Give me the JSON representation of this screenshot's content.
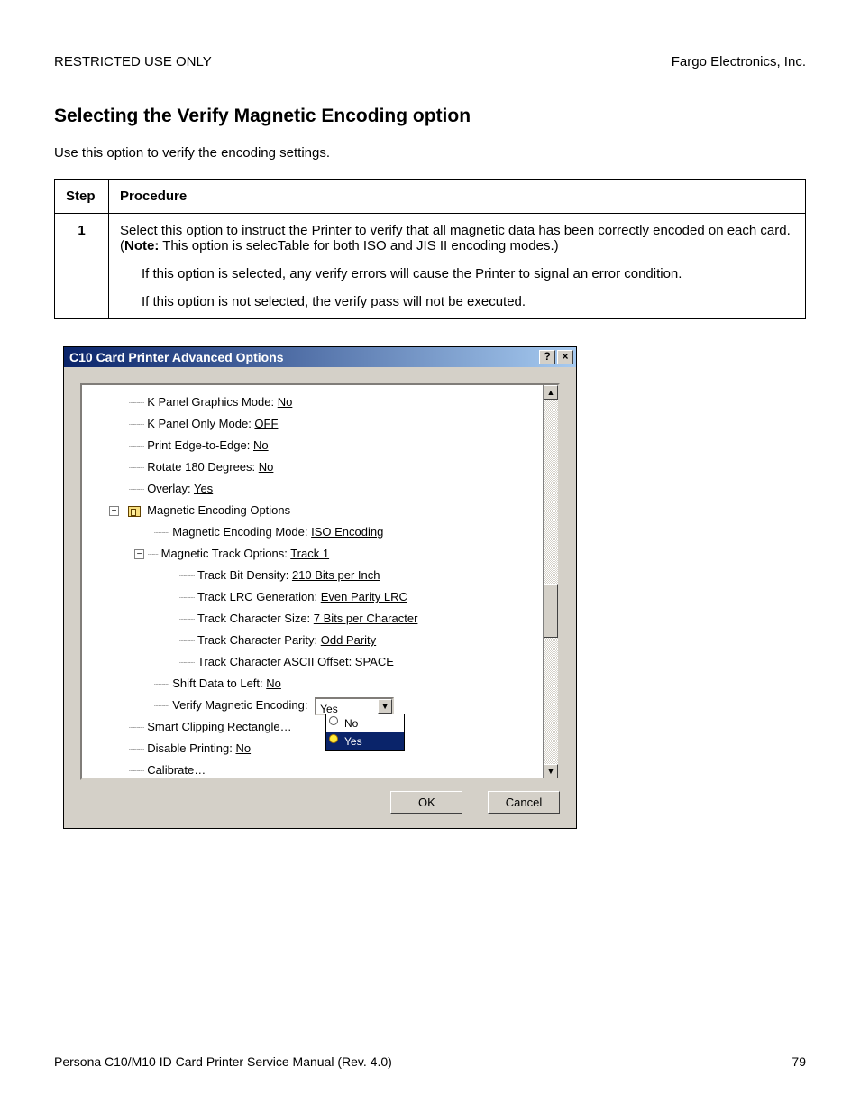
{
  "header": {
    "left": "RESTRICTED USE ONLY",
    "right": "Fargo Electronics, Inc."
  },
  "title": "Selecting the Verify Magnetic Encoding option",
  "intro": "Use this option to verify the encoding settings.",
  "table": {
    "col_step": "Step",
    "col_proc": "Procedure",
    "step_num": "1",
    "p1a": "Select this option to instruct the Printer to verify that all magnetic data has been correctly encoded on each card. (",
    "p1_note": "Note:",
    "p1b": "  This option is selecTable for both ISO and JIS II encoding modes.)",
    "p2": "If this option is selected, any verify errors will cause the Printer to signal an error condition.",
    "p3": "If this option is not selected, the verify pass will not be executed."
  },
  "dialog": {
    "title": "C10 Card Printer Advanced Options",
    "tree": {
      "k_panel_graphics_label": "K Panel Graphics Mode: ",
      "k_panel_graphics_value": "No",
      "k_panel_only_label": "K Panel Only Mode: ",
      "k_panel_only_value": "OFF",
      "print_edge_label": "Print Edge-to-Edge: ",
      "print_edge_value": "No",
      "rotate_label": "Rotate 180 Degrees: ",
      "rotate_value": "No",
      "overlay_label": "Overlay: ",
      "overlay_value": "Yes",
      "mag_options": "Magnetic Encoding Options",
      "mag_mode_label": "Magnetic Encoding Mode: ",
      "mag_mode_value": "ISO Encoding",
      "mag_track_label": "Magnetic Track Options: ",
      "mag_track_value": "Track 1",
      "bit_density_label": "Track Bit Density: ",
      "bit_density_value": "210 Bits per Inch",
      "lrc_label": "Track LRC Generation: ",
      "lrc_value": "Even Parity LRC",
      "char_size_label": "Track Character Size: ",
      "char_size_value": "7 Bits per Character",
      "char_parity_label": "Track Character Parity: ",
      "char_parity_value": "Odd Parity",
      "ascii_offset_label": "Track Character ASCII Offset: ",
      "ascii_offset_value": "SPACE",
      "shift_label": "Shift Data to Left: ",
      "shift_value": "No",
      "verify_label": "Verify Magnetic Encoding:",
      "verify_combo_value": "Yes",
      "verify_opt_no": "No",
      "verify_opt_yes": "Yes",
      "smart_clip": "Smart Clipping Rectangle…",
      "disable_print_label": "Disable Printing: ",
      "disable_print_value": "No",
      "calibrate": "Calibrate…"
    },
    "ok": "OK",
    "cancel": "Cancel"
  },
  "footer": {
    "left": "Persona C10/M10 ID Card Printer Service Manual (Rev. 4.0)",
    "page": "79"
  }
}
